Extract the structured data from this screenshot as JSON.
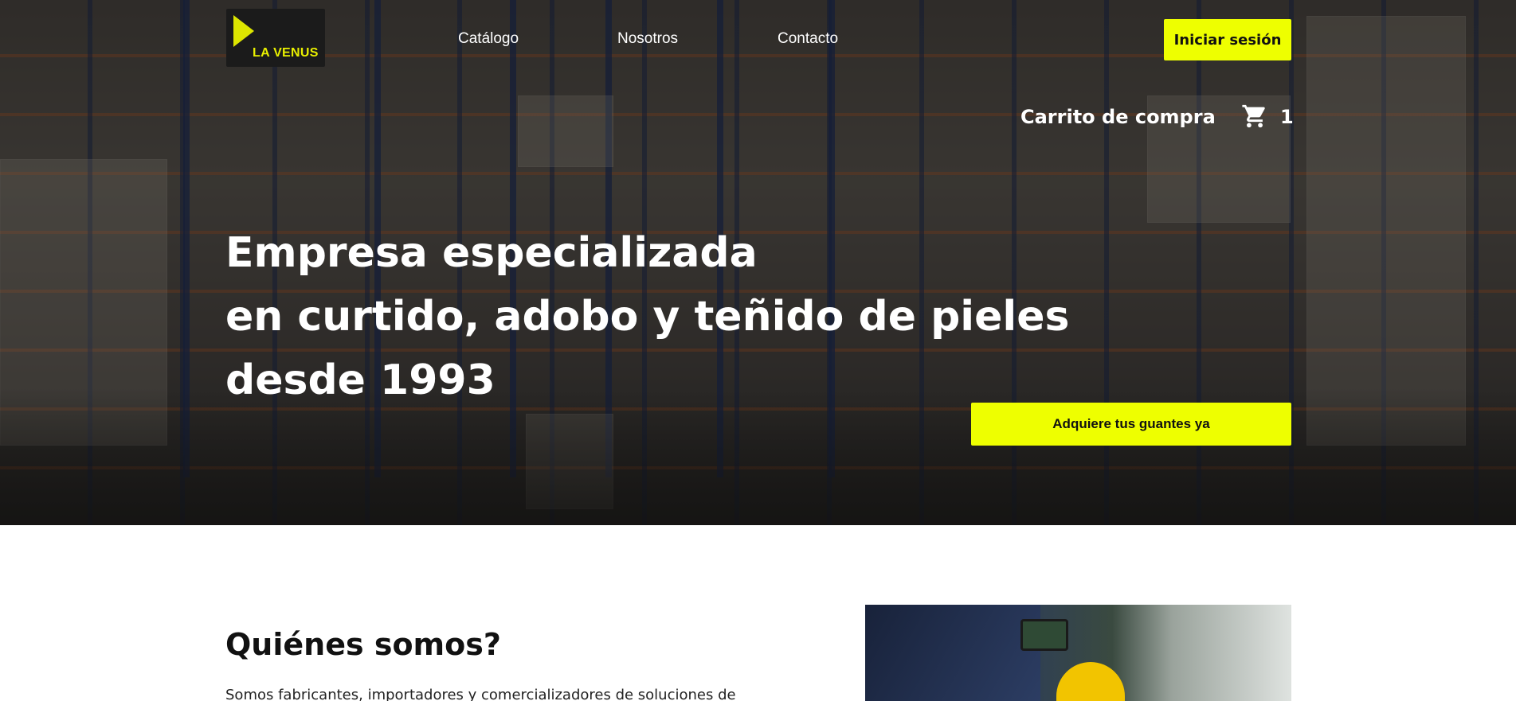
{
  "brand": {
    "logo_text": "LA VENUS",
    "accent": "#eeff00"
  },
  "nav": {
    "links": [
      "Catálogo",
      "Nosotros",
      "Contacto"
    ],
    "login_label": "Iniciar sesión"
  },
  "cart": {
    "label": "Carrito de compra",
    "count": "1",
    "icon": "shopping-cart-icon"
  },
  "hero": {
    "title_lines": [
      "Empresa especializada",
      "en curtido, adobo y teñido de pieles",
      "desde 1993"
    ],
    "cta_label": "Adquiere tus guantes ya"
  },
  "about": {
    "title": "Quiénes somos?",
    "text": "Somos fabricantes, importadores y comercializadores de soluciones de"
  }
}
